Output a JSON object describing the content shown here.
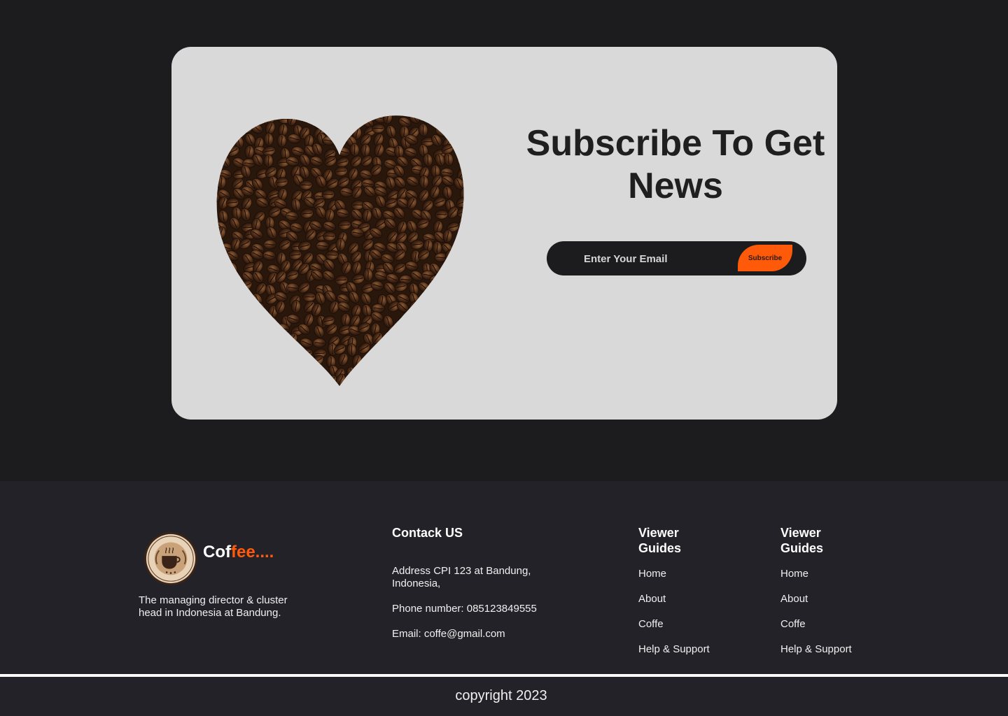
{
  "subscribe": {
    "title": "Subscribe To Get News",
    "email_placeholder": "Enter Your Email",
    "button_label": "Subscribe",
    "accent_color": "#ff5a0a"
  },
  "footer": {
    "brand": {
      "logo_icon": "coffee-shop-logo",
      "name_prefix": "Cof",
      "name_suffix": "fee....",
      "logo_text_top": "COFFEE SHOP",
      "logo_text_bottom": "TAKE REST AND BE HAPPY",
      "description": "The managing director & cluster head in Indonesia at Bandung."
    },
    "contact": {
      "title": "Contack US",
      "address": "Address CPI 123 at Bandung, Indonesia,",
      "phone": "Phone number: 085123849555",
      "email": "Email: coffe@gmail.com"
    },
    "guides": [
      {
        "title": "Viewer Guides",
        "links": [
          "Home",
          "About",
          "Coffe",
          "Help & Support"
        ]
      },
      {
        "title": "Viewer Guides",
        "links": [
          "Home",
          "About",
          "Coffe",
          "Help & Support"
        ]
      }
    ],
    "copyright": "copyright 2023"
  }
}
